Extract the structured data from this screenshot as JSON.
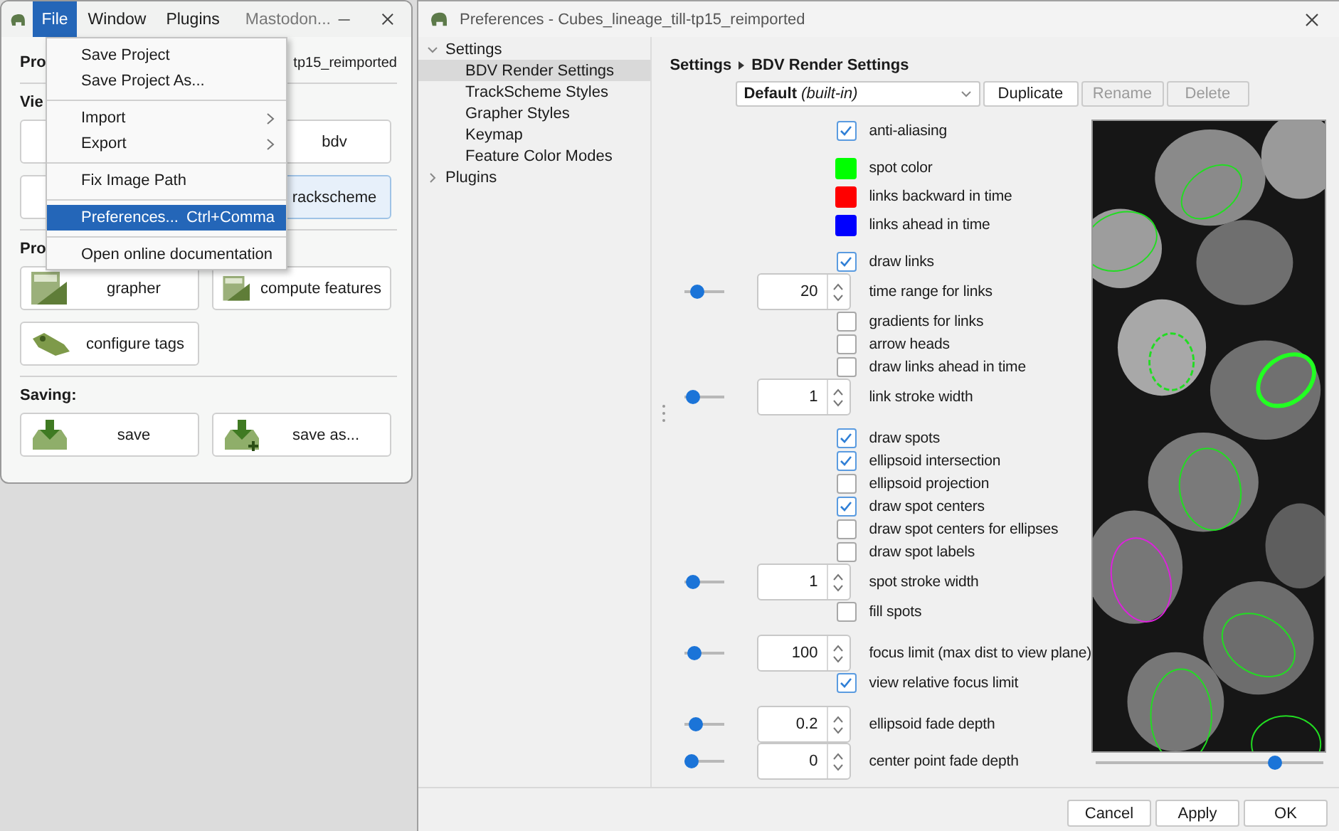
{
  "main_window": {
    "menus": [
      {
        "label": "File",
        "selected": true
      },
      {
        "label": "Window",
        "selected": false
      },
      {
        "label": "Plugins",
        "selected": false
      }
    ],
    "title": "Mastodon...",
    "project": {
      "label": "Pro",
      "value": "tp15_reimported"
    },
    "sections": [
      {
        "label": "Vie",
        "buttons": [
          {
            "kind": "plain",
            "highlighted": false
          },
          {
            "kind": "plain",
            "label": "bdv",
            "highlighted": false
          },
          {
            "kind": "plain",
            "highlighted": false
          },
          {
            "kind": "plain",
            "label": "rackscheme",
            "highlighted": true
          }
        ]
      },
      {
        "label": "Pro",
        "buttons": [
          {
            "kind": "grapher",
            "label": "grapher"
          },
          {
            "kind": "features",
            "label": "compute features"
          },
          {
            "kind": "tags",
            "label": "configure tags"
          }
        ]
      },
      {
        "label": "Saving:",
        "buttons": [
          {
            "kind": "save",
            "label": "save"
          },
          {
            "kind": "save_as",
            "label": "save as..."
          }
        ]
      }
    ]
  },
  "file_menu": [
    {
      "kind": "item",
      "label": "Save Project",
      "selected": false
    },
    {
      "kind": "item",
      "label": "Save Project As...",
      "selected": false
    },
    {
      "kind": "separator"
    },
    {
      "kind": "submenu",
      "label": "Import",
      "selected": false
    },
    {
      "kind": "submenu",
      "label": "Export",
      "selected": false
    },
    {
      "kind": "separator"
    },
    {
      "kind": "item",
      "label": "Fix Image Path",
      "selected": false
    },
    {
      "kind": "separator"
    },
    {
      "kind": "item",
      "label": "Preferences...",
      "shortcut": "Ctrl+Comma",
      "selected": true
    },
    {
      "kind": "separator"
    },
    {
      "kind": "item",
      "label": "Open online documentation",
      "selected": false
    }
  ],
  "preferences": {
    "title": "Preferences - Cubes_lineage_till-tp15_reimported",
    "tree": [
      {
        "label": "Settings",
        "expanded": true,
        "selected": false,
        "children": [
          {
            "label": "BDV Render Settings",
            "selected": true
          },
          {
            "label": "TrackScheme Styles",
            "selected": false
          },
          {
            "label": "Grapher Styles",
            "selected": false
          },
          {
            "label": "Keymap",
            "selected": false
          },
          {
            "label": "Feature Color Modes",
            "selected": false
          }
        ]
      },
      {
        "label": "Plugins",
        "expanded": false,
        "selected": false
      }
    ],
    "breadcrumb": [
      "Settings",
      "BDV Render Settings"
    ],
    "style_select": "**Default** *(built-in)*",
    "style_buttons": [
      {
        "label": "Duplicate",
        "disabled": false
      },
      {
        "label": "Rename",
        "disabled": true
      },
      {
        "label": "Delete",
        "disabled": true
      }
    ],
    "groups": [
      {
        "rows": [
          {
            "kind": "checkbox",
            "label": "anti-aliasing",
            "checked": true
          }
        ]
      },
      {
        "rows": [
          {
            "kind": "color",
            "label": "spot color",
            "color": "#00ff00"
          },
          {
            "kind": "color",
            "label": "links backward in time",
            "color": "#ff0000"
          },
          {
            "kind": "color",
            "label": "links ahead in time",
            "color": "#0000ff"
          }
        ]
      },
      {
        "rows": [
          {
            "kind": "checkbox",
            "label": "draw links",
            "checked": true
          },
          {
            "kind": "number",
            "label": "time range for links",
            "value": "20",
            "level": 0.25
          },
          {
            "kind": "checkbox",
            "label": "gradients for links",
            "checked": false
          },
          {
            "kind": "checkbox",
            "label": "arrow heads",
            "checked": false
          },
          {
            "kind": "checkbox",
            "label": "draw links ahead in time",
            "checked": false
          },
          {
            "kind": "number",
            "label": "link stroke width",
            "value": "1",
            "level": 0.05
          }
        ]
      },
      {
        "rows": [
          {
            "kind": "checkbox",
            "label": "draw spots",
            "checked": true
          },
          {
            "kind": "checkbox",
            "label": "ellipsoid intersection",
            "checked": true
          },
          {
            "kind": "checkbox",
            "label": "ellipsoid projection",
            "checked": false
          },
          {
            "kind": "checkbox",
            "label": "draw spot centers",
            "checked": true
          },
          {
            "kind": "checkbox",
            "label": "draw spot centers for ellipses",
            "checked": false
          },
          {
            "kind": "checkbox",
            "label": "draw spot labels",
            "checked": false
          },
          {
            "kind": "number",
            "label": "spot stroke width",
            "value": "1",
            "level": 0.05
          },
          {
            "kind": "checkbox",
            "label": "fill spots",
            "checked": false
          }
        ]
      },
      {
        "rows": [
          {
            "kind": "number",
            "label": "focus limit (max dist to view plane)",
            "value": "100",
            "level": 0.1
          },
          {
            "kind": "checkbox",
            "label": "view relative focus limit",
            "checked": true
          }
        ]
      },
      {
        "rows": [
          {
            "kind": "number",
            "label": "ellipsoid fade depth",
            "value": "0.2",
            "level": 0.2
          },
          {
            "kind": "number",
            "label": "center point fade depth",
            "value": "0",
            "level": 0.0
          }
        ]
      }
    ],
    "preview": {
      "kind": "picture",
      "slider": {
        "level": 0.81
      }
    },
    "buttons": [
      "Cancel",
      "Apply",
      "OK"
    ]
  }
}
